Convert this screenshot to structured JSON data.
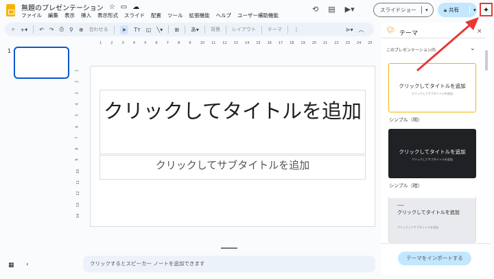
{
  "doc": {
    "title": "無題のプレゼンテーション"
  },
  "menu": [
    "ファイル",
    "編集",
    "表示",
    "挿入",
    "表示形式",
    "スライド",
    "配置",
    "ツール",
    "拡張機能",
    "ヘルプ",
    "ユーザー補助機能"
  ],
  "toolbar": {
    "zoom": "合わせる",
    "background": "背景",
    "layout": "レイアウト",
    "theme": "テーマ"
  },
  "header": {
    "slideshow": "スライドショー",
    "share": "共有"
  },
  "ruler": {
    "h": [
      "1",
      "2",
      "3",
      "4",
      "5",
      "6",
      "7",
      "8",
      "9",
      "10",
      "11",
      "12",
      "13",
      "14",
      "15",
      "16",
      "17",
      "18",
      "19",
      "20",
      "21",
      "22",
      "23",
      "24",
      "25"
    ],
    "v": [
      "1",
      "2",
      "3",
      "4",
      "5",
      "6",
      "7",
      "8",
      "9",
      "10",
      "11",
      "12",
      "13",
      "14"
    ]
  },
  "filmstrip": {
    "slide_number": "1"
  },
  "slide": {
    "title": "クリックしてタイトルを追加",
    "subtitle": "クリックしてサブタイトルを追加"
  },
  "notes": {
    "placeholder": "クリックするとスピーカー ノートを追加できます"
  },
  "theme_panel": {
    "title": "テーマ",
    "section": "このプレゼンテーション内",
    "themes": [
      {
        "name": "シンプル（明）",
        "title": "クリックしてタイトルを追加",
        "subtitle": "クリックしてサブタイトルを追加"
      },
      {
        "name": "シンプル（暗）",
        "title": "クリックしてタイトルを追加",
        "subtitle": "クリックしてサブタイトルを追加"
      },
      {
        "name": "",
        "title": "クリックしてタイトルを追加",
        "subtitle": "クリックしてサブタイトルを追加"
      }
    ],
    "import": "テーマをインポートする"
  },
  "colors": {
    "accent": "#0b57d0",
    "highlight": "#e53935",
    "share_bg": "#c2e7ff"
  }
}
